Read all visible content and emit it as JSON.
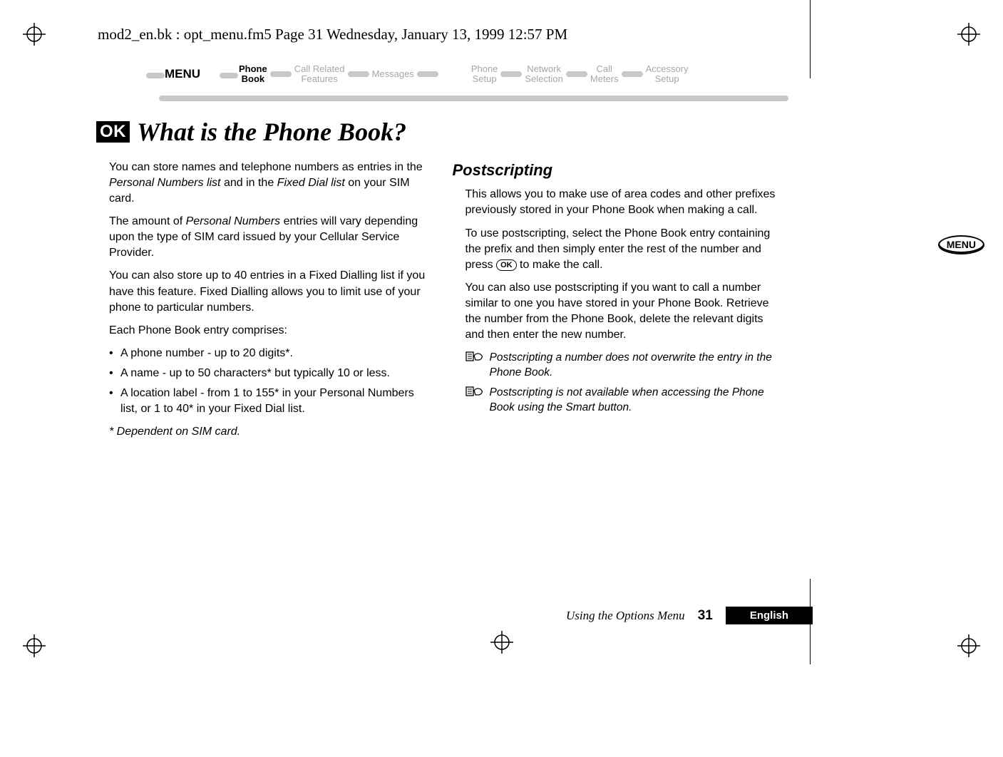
{
  "running_header": "mod2_en.bk : opt_menu.fm5  Page 31  Wednesday, January 13, 1999  12:57 PM",
  "menupath": {
    "menu_label": "MENU",
    "items": [
      {
        "line1": "Phone",
        "line2": "Book",
        "active": true
      },
      {
        "line1": "Call Related",
        "line2": "Features",
        "active": false
      },
      {
        "line1": "Messages",
        "line2": "",
        "active": false
      },
      {
        "line1": "Phone",
        "line2": "Setup",
        "active": false
      },
      {
        "line1": "Network",
        "line2": "Selection",
        "active": false
      },
      {
        "line1": "Call",
        "line2": "Meters",
        "active": false
      },
      {
        "line1": "Accessory",
        "line2": "Setup",
        "active": false
      }
    ]
  },
  "heading": {
    "ok_badge": "OK",
    "title": "What is the Phone Book?"
  },
  "left_column": {
    "p1_a": "You can store names and telephone numbers as entries in the ",
    "p1_b": "Personal Numbers list",
    "p1_c": " and in the ",
    "p1_d": "Fixed Dial list",
    "p1_e": " on your SIM card.",
    "p2_a": "The amount of ",
    "p2_b": "Personal Numbers",
    "p2_c": " entries will vary depending upon the type of SIM card issued by your Cellular Service Provider.",
    "p3": "You can also store up to 40 entries in a Fixed Dialling list if you have this feature. Fixed Dialling allows you to limit use of your phone to particular numbers.",
    "p4": "Each Phone Book entry comprises:",
    "bullets": [
      "A phone number - up to 20 digits*.",
      "A name - up to 50 characters* but typically 10 or less.",
      "A location label - from 1 to 155* in your Personal Numbers list, or 1 to 40* in your Fixed Dial list."
    ],
    "footnote": "* Dependent on SIM card."
  },
  "right_column": {
    "subhead": "Postscripting",
    "p1": "This allows you to make use of area codes and other prefixes previously stored in your Phone Book when making a call.",
    "p2_a": "To use postscripting, select the Phone Book entry containing the prefix and then simply enter the rest of the number and press ",
    "p2_ok": "OK",
    "p2_b": " to make the call.",
    "p3": "You can also use postscripting if you want to call a number similar to one you have stored in your Phone Book. Retrieve the number from the Phone Book, delete the relevant digits and then enter the new number.",
    "note1": "Postscripting a number does not overwrite the entry in the Phone Book.",
    "note2": "Postscripting is not available when accessing the Phone Book using the Smart button."
  },
  "side_menu_label": "MENU",
  "footer": {
    "using": "Using the Options Menu",
    "page": "31",
    "language": "English"
  }
}
